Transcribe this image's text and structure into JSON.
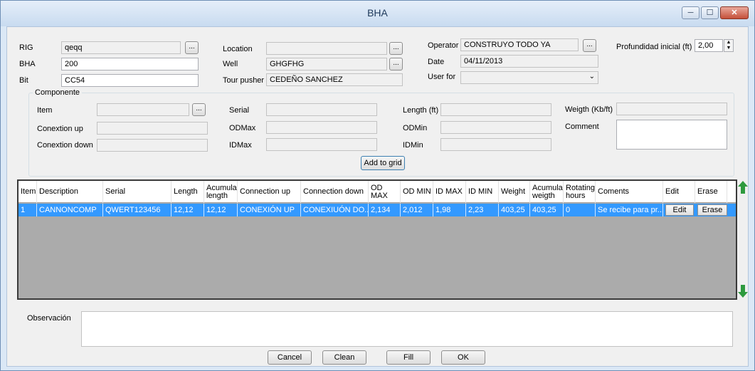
{
  "window": {
    "title": "BHA",
    "min": "─",
    "max": "☐",
    "close": "✕"
  },
  "header": {
    "rig_label": "RIG",
    "rig_value": "qeqq",
    "bha_label": "BHA",
    "bha_value": "200",
    "bit_label": "Bit",
    "bit_value": "CC54",
    "location_label": "Location",
    "location_value": "",
    "well_label": "Well",
    "well_value": "GHGFHG",
    "tourpusher_label": "Tour pusher",
    "tourpusher_value": "CEDEÑO SANCHEZ",
    "operator_label": "Operator",
    "operator_value": "CONSTRUYO TODO YA",
    "date_label": "Date",
    "date_value": "04/11/2013",
    "userfor_label": "User for",
    "userfor_value": "",
    "prof_label": "Profundidad inicial (ft)",
    "prof_value": "2,00",
    "browse": "..."
  },
  "componente": {
    "title": "Componente",
    "item_label": "Item",
    "conexion_up_label": "Conextion up",
    "conexion_down_label": "Conextion down",
    "serial_label": "Serial",
    "odmax_label": "ODMax",
    "idmax_label": "IDMax",
    "length_label": "Length (ft)",
    "odmin_label": "ODMin",
    "idmin_label": "IDMin",
    "weight_label": "Weigth (Kb/ft)",
    "comment_label": "Comment",
    "add_button": "Add to grid"
  },
  "grid": {
    "headers": [
      "Item",
      "Description",
      "Serial",
      "Length",
      "Acumula length",
      "Connection up",
      "Connection down",
      "OD MAX",
      "OD MIN",
      "ID MAX",
      "ID MIN",
      "Weight",
      "Acumula weigth",
      "Rotating hours",
      "Coments",
      "Edit",
      "Erase"
    ],
    "rows": [
      [
        "1",
        "CANNONCOMP",
        "QWERT123456",
        "12,12",
        "12,12",
        "CONEXIÓN UP",
        "CONEXIUÓN DO...",
        "2,134",
        "2,012",
        "1,98",
        "2,23",
        "403,25",
        "403,25",
        "0",
        "Se recibe para pr...",
        "Edit",
        "Erase"
      ]
    ]
  },
  "observacion": {
    "label": "Observación",
    "value": ""
  },
  "footer": {
    "cancel": "Cancel",
    "clean": "Clean",
    "fill": "Fill",
    "ok": "OK"
  },
  "colors": {
    "selection": "#3399ff",
    "grid_bg": "#ababab",
    "arrow": "#2e9a3e"
  },
  "icons": {
    "scroll_up": "green-up-arrow-icon",
    "scroll_down": "green-down-arrow-icon",
    "spin": "spinner-arrows-icon",
    "dropdown": "chevron-down-icon"
  }
}
